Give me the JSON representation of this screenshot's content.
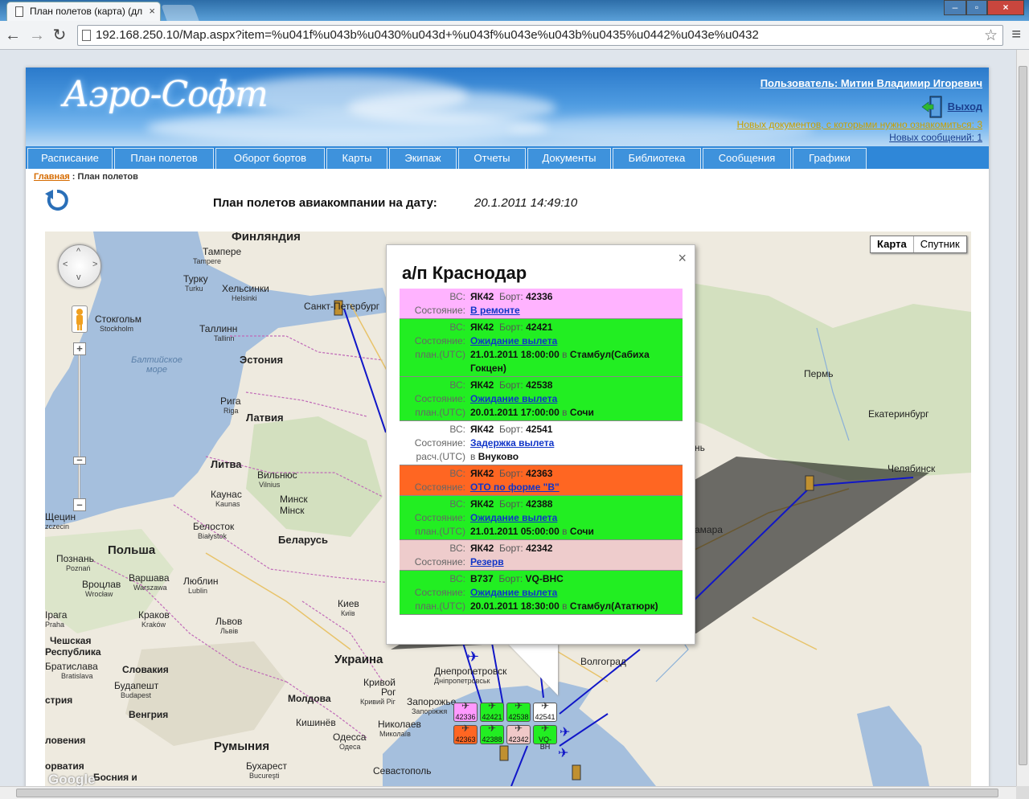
{
  "browser": {
    "tab_title": "План полетов (карта) (дл",
    "url": "192.168.250.10/Map.aspx?item=%u041f%u043b%u0430%u043d+%u043f%u043e%u043b%u0435%u0442%u043e%u0432"
  },
  "site": {
    "logo": "Аэро-Софт",
    "user_label": "Пользователь: Митин Владимир Игоревич",
    "logout_label": "Выход",
    "new_docs": "Новых документов, с которыми нужно ознакомиться: 3",
    "new_messages": "Новых сообщений: 1"
  },
  "nav": [
    {
      "label": "Расписание"
    },
    {
      "label": "План полетов"
    },
    {
      "label": "Оборот бортов"
    },
    {
      "label": "Карты"
    },
    {
      "label": "Экипаж"
    },
    {
      "label": "Отчеты"
    },
    {
      "label": "Документы"
    },
    {
      "label": "Библиотека"
    },
    {
      "label": "Сообщения"
    },
    {
      "label": "Графики"
    }
  ],
  "breadcrumb": {
    "home": "Главная",
    "separator": " : ",
    "current": "План полетов"
  },
  "plan": {
    "title": "План полетов авиакомпании на дату:",
    "date": "20.1.2011 14:49:10"
  },
  "map": {
    "type_map": "Карта",
    "type_satellite": "Спутник",
    "google": "Google",
    "labels": {
      "finland": "Финляндия",
      "tampere": "Тампере",
      "tampere_sub": "Tampere",
      "turku": "Турку",
      "turku_sub": "Turku",
      "helsinki": "Хельсинки",
      "helsinki_sub": "Helsinki",
      "stockholm": "Стокгольм",
      "stockholm_sub": "Stockholm",
      "tallinn": "Таллинн",
      "tallinn_sub": "Tallinn",
      "spb": "Санкт-Петербург",
      "baltic_sea": "Балтийское море",
      "estonia": "Эстония",
      "riga": "Рига",
      "riga_sub": "Riga",
      "latvia": "Латвия",
      "lithuania": "Литва",
      "vilnius": "Вильнюс",
      "vilnius_sub": "Vilnius",
      "kaunas": "Каунас",
      "kaunas_sub": "Kaunas",
      "minsk": "Минск",
      "minsk_sub": "Мінск",
      "belarus": "Беларусь",
      "belostok": "Белосток",
      "belostok_sub": "Białystok",
      "poland": "Польша",
      "poznan": "Познань",
      "poznan_sub": "Poznań",
      "warsaw": "Варшава",
      "warsaw_sub": "Warszawa",
      "wroclaw": "Вроцлав",
      "wroclaw_sub": "Wrocław",
      "lublin": "Люблин",
      "lublin_sub": "Lublin",
      "krakow": "Краков",
      "krakow_sub": "Kraków",
      "lviv": "Львов",
      "lviv_sub": "Львів",
      "kyiv": "Киев",
      "kyiv_sub": "Київ",
      "prague": "Ірага",
      "prague_sub": "Praha",
      "czech": "Чешская",
      "czech2": "Республика",
      "bratislava": "Братислава",
      "bratislava_sub": "Bratislava",
      "slovakia": "Словакия",
      "budapest": "Будапешт",
      "budapest_sub": "Budapest",
      "hungary": "Венгрия",
      "austria": "стрия",
      "slovenia": "ловения",
      "croatia": "орватия",
      "bosnia": "Босния и",
      "ukraine": "Украина",
      "dnipro": "Днепропетровск",
      "dnipro_sub": "Днiпропетровськ",
      "krivoy": "Кривой",
      "krivoy2": "Рог",
      "krivoy_sub": "Кривий Ріг",
      "zaporozhye": "Запорожье",
      "zaporozhye_sub": "Запоріжжя",
      "moldova": "Молдова",
      "chisinau": "Кишинёв",
      "mykolaiv": "Николаев",
      "mykolaiv_sub": "Миколаїв",
      "odessa": "Одесса",
      "odessa_sub": "Одеса",
      "romania": "Румыния",
      "bucharest": "Бухарест",
      "bucharest_sub": "Bucureşti",
      "sevastopol": "Севастополь",
      "volgograd": "Волгоград",
      "samara": "амара",
      "perm": "Пермь",
      "ekaterinburg": "Екатеринбург",
      "chelyabinsk": "Челябинск",
      "szczecin": "Щецин",
      "szczecin_sub": "zczecin",
      "nh": "нь"
    },
    "airports": [
      {
        "code": "42336",
        "color": "#ff99ff"
      },
      {
        "code": "42421",
        "color": "#22ee22"
      },
      {
        "code": "42538",
        "color": "#22ee22"
      },
      {
        "code": "42541",
        "color": "#ffffff"
      },
      {
        "code": "42363",
        "color": "#ff6622"
      },
      {
        "code": "42388",
        "color": "#22ee22"
      },
      {
        "code": "42342",
        "color": "#f0c8c8"
      },
      {
        "code": "VQ-BH",
        "color": "#22ee22"
      }
    ]
  },
  "popup": {
    "title": "а/п Краснодар",
    "labels": {
      "vs": "ВС:",
      "bort": "Борт:",
      "state": "Состояние:",
      "plan": "план.(UTC)",
      "calc": "расч.(UTC)",
      "to": "в"
    },
    "rows": [
      {
        "color": "#ffb3ff",
        "vs": "ЯК42",
        "bort": "42336",
        "state": "В ремонте",
        "time_label": "",
        "time": "",
        "dest": ""
      },
      {
        "color": "#22ee22",
        "vs": "ЯК42",
        "bort": "42421",
        "state": "Ожидание вылета",
        "time_label": "план.(UTC)",
        "time": "21.01.2011 18:00:00",
        "dest": "Стамбул(Сабиха Гокцен)"
      },
      {
        "color": "#22ee22",
        "vs": "ЯК42",
        "bort": "42538",
        "state": "Ожидание вылета",
        "time_label": "план.(UTC)",
        "time": "20.01.2011 17:00:00",
        "dest": "Сочи"
      },
      {
        "color": "#ffffff",
        "vs": "ЯК42",
        "bort": "42541",
        "state": "Задержка вылета",
        "time_label": "расч.(UTC)",
        "time": "",
        "dest": "Внуково"
      },
      {
        "color": "#ff6622",
        "vs": "ЯК42",
        "bort": "42363",
        "state": "ОТО по форме \"В\"",
        "time_label": "",
        "time": "",
        "dest": ""
      },
      {
        "color": "#22ee22",
        "vs": "ЯК42",
        "bort": "42388",
        "state": "Ожидание вылета",
        "time_label": "план.(UTC)",
        "time": "21.01.2011 05:00:00",
        "dest": "Сочи"
      },
      {
        "color": "#eecccc",
        "vs": "ЯК42",
        "bort": "42342",
        "state": "Резерв",
        "time_label": "",
        "time": "",
        "dest": ""
      },
      {
        "color": "#22ee22",
        "vs": "B737",
        "bort": "VQ-BHC",
        "state": "Ожидание вылета",
        "time_label": "план.(UTC)",
        "time": "20.01.2011 18:30:00",
        "dest": "Стамбул(Ататюрк)"
      }
    ]
  }
}
